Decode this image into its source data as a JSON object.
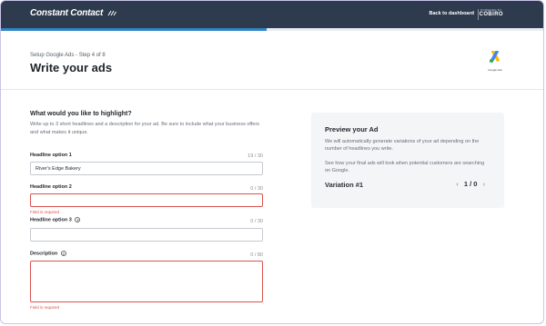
{
  "header": {
    "brand": "Constant Contact",
    "back_link": "Back to dashboard",
    "powered_by": "POWERED BY",
    "partner": "COBIRO"
  },
  "progress": {
    "step": 4,
    "total": 8,
    "fraction": 0.49
  },
  "page": {
    "step_text": "Setup Google Ads - Step 4 of 8",
    "title": "Write your ads",
    "logo_label": "Google Ads"
  },
  "form": {
    "section_title": "What would you like to highlight?",
    "section_desc": "Write up to 3 short headlines and a description for your ad. Be sure to include what your business offers and what makes it unique.",
    "headline1": {
      "label": "Headline option 1",
      "value": "River's Edge Bakery",
      "counter": "19 / 30"
    },
    "headline2": {
      "label": "Headline option 2",
      "value": "",
      "counter": "0 / 30",
      "error": "Field is required"
    },
    "headline3": {
      "label": "Headline option 3",
      "value": "",
      "counter": "0 / 30"
    },
    "description": {
      "label": "Description",
      "value": "",
      "counter": "0 / 80",
      "error": "Field is required"
    },
    "help_glyph": "?"
  },
  "preview": {
    "title": "Preview your Ad",
    "text1": "We will automatically generate variations of your ad depending on the number of headlines you write.",
    "text2": "See how your final ads will look when potential customers are searching on Google.",
    "variation_label": "Variation #1",
    "pager": "1 / 0",
    "prev_icon": "‹",
    "next_icon": "›"
  },
  "colors": {
    "header_bg": "#2e3b4e",
    "progress": "#2f86c7",
    "error": "#d9534f",
    "card_bg": "#f4f5f7"
  }
}
